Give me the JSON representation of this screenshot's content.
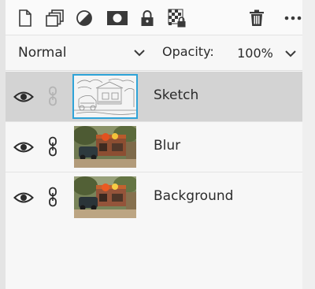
{
  "toolbar": {
    "icons": [
      "new-layer-icon",
      "duplicate-layer-icon",
      "adjustment-layer-icon",
      "mask-icon",
      "lock-icon",
      "lock-transparency-icon",
      "trash-icon",
      "more-icon"
    ]
  },
  "options": {
    "blend_mode": "Normal",
    "opacity_label": "Opacity:",
    "opacity_value": "100%"
  },
  "layers": [
    {
      "name": "Sketch",
      "selected": true,
      "visible": true,
      "linked": false
    },
    {
      "name": "Blur",
      "selected": false,
      "visible": true,
      "linked": true
    },
    {
      "name": "Background",
      "selected": false,
      "visible": true,
      "linked": true
    }
  ],
  "colors": {
    "selection_bg": "#d3d3d3",
    "selection_border": "#2ea3d8",
    "icon": "#3a3a3a"
  }
}
